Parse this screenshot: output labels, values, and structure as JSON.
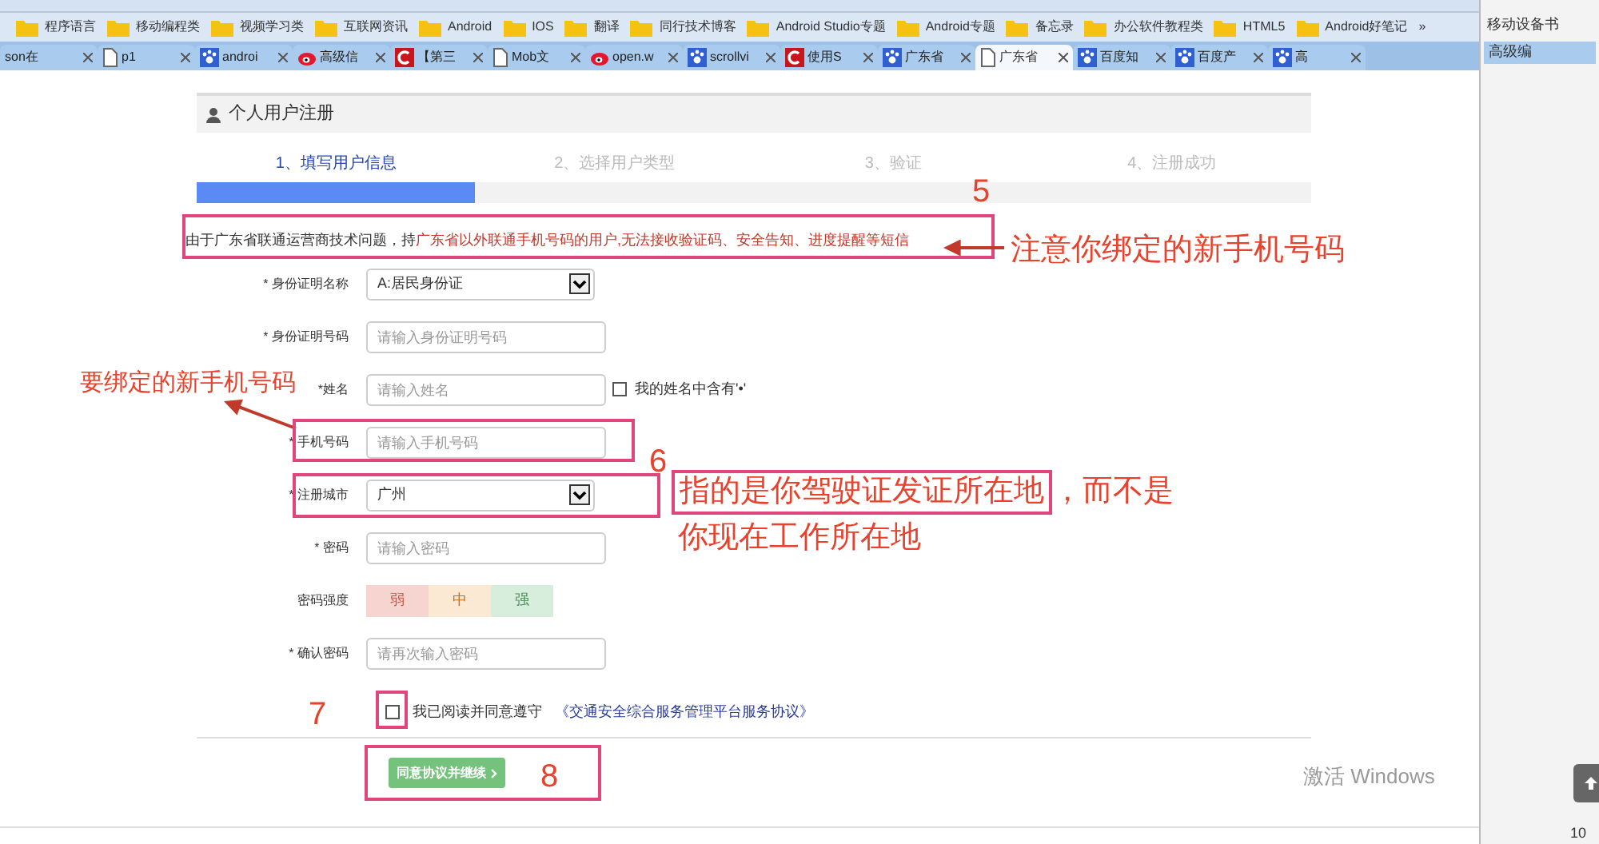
{
  "bookmarks": [
    {
      "label": "程序语言"
    },
    {
      "label": "移动编程类"
    },
    {
      "label": "视频学习类"
    },
    {
      "label": "互联网资讯"
    },
    {
      "label": "Android"
    },
    {
      "label": "IOS"
    },
    {
      "label": "翻译"
    },
    {
      "label": "同行技术博客"
    },
    {
      "label": "Android Studio专题"
    },
    {
      "label": "Android专题"
    },
    {
      "label": "备忘录"
    },
    {
      "label": "办公软件教程类"
    },
    {
      "label": "HTML5"
    },
    {
      "label": "Android好笔记"
    }
  ],
  "more": "»",
  "tabs": [
    {
      "label": "son在",
      "kind": "none",
      "selected": false
    },
    {
      "label": "p1",
      "kind": "doc",
      "selected": false
    },
    {
      "label": "androi",
      "kind": "paw",
      "selected": false
    },
    {
      "label": "高级信",
      "kind": "weibo",
      "selected": false
    },
    {
      "label": "【第三",
      "kind": "c",
      "selected": false
    },
    {
      "label": "Mob文",
      "kind": "doc",
      "selected": false
    },
    {
      "label": "open.w",
      "kind": "weibo",
      "selected": false
    },
    {
      "label": "scrollvi",
      "kind": "paw",
      "selected": false
    },
    {
      "label": "使用S",
      "kind": "c",
      "selected": false
    },
    {
      "label": "广东省",
      "kind": "paw",
      "selected": false
    },
    {
      "label": "广东省",
      "kind": "doc",
      "selected": true
    },
    {
      "label": "百度知",
      "kind": "paw",
      "selected": false
    },
    {
      "label": "百度产",
      "kind": "paw",
      "selected": false
    },
    {
      "label": "高",
      "kind": "paw",
      "selected": false
    }
  ],
  "side_window": {
    "bookmark": "移动设备书",
    "tab": "高级编",
    "zoom": "10"
  },
  "page": {
    "title": "个人用户注册",
    "steps": [
      {
        "label": "1、填写用户信息",
        "selected": true
      },
      {
        "label": "2、选择用户类型",
        "selected": false
      },
      {
        "label": "3、验证",
        "selected": false
      },
      {
        "label": "4、注册成功",
        "selected": false
      }
    ],
    "progress": {
      "level": 0.25
    },
    "notice": [
      {
        "text": "由于广东省联通运营商技术问题，持",
        "emphasis": false
      },
      {
        "text": "广东省以外联通手机号码的用户,无法接收验证码、安全告知、进度提醒等短信",
        "emphasis": true
      }
    ],
    "fields": [
      {
        "kind": "select",
        "label": "* 身份证明名称",
        "value": "A:居民身份证"
      },
      {
        "kind": "input",
        "label": "* 身份证明号码",
        "placeholder": "请输入身份证明号码"
      },
      {
        "kind": "input",
        "label": "*姓名",
        "placeholder": "请输入姓名",
        "option": {
          "label": "我的姓名中含有'•'",
          "checked": false
        }
      },
      {
        "kind": "input",
        "label": "* 手机号码",
        "placeholder": "请输入手机号码"
      },
      {
        "kind": "select",
        "label": "* 注册城市",
        "value": "广州"
      },
      {
        "kind": "input",
        "label": "* 密码",
        "placeholder": "请输入密码"
      },
      {
        "kind": "strength",
        "label": "密码强度",
        "levels": [
          "弱",
          "中",
          "强"
        ]
      },
      {
        "kind": "input",
        "label": "* 确认密码",
        "placeholder": "请再次输入密码"
      }
    ],
    "agreement": {
      "checked": false,
      "text": "我已阅读并同意遵守",
      "link": "《交通安全综合服务管理平台服务协议》"
    },
    "submit": "同意协议并继续"
  },
  "annotations": {
    "n5": "5",
    "note5": "注意你绑定的新手机号码",
    "note_phone": "要绑定的新手机号码",
    "n6": "6",
    "note6a": "指的是你驾驶证发证所在地",
    "note6b": "，而不是",
    "note6c": "你现在工作所在地",
    "n7": "7",
    "n8": "8"
  },
  "os_notice": "激活 Windows"
}
